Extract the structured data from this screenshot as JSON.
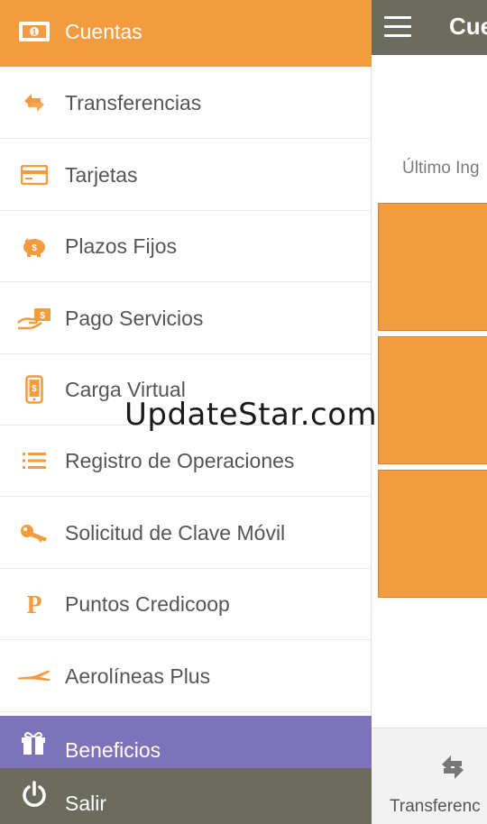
{
  "app": {
    "title": "Cue",
    "last_login": "Último Ing",
    "bottom_nav": {
      "transfer_label": "Transferenc"
    }
  },
  "drawer": {
    "items": [
      {
        "label": "Cuentas",
        "icon": "cash-icon",
        "active": true
      },
      {
        "label": "Transferencias",
        "icon": "transfer-icon"
      },
      {
        "label": "Tarjetas",
        "icon": "credit-card-icon"
      },
      {
        "label": "Plazos Fijos",
        "icon": "piggy-bank-icon"
      },
      {
        "label": "Pago Servicios",
        "icon": "bill-payment-icon"
      },
      {
        "label": "Carga Virtual",
        "icon": "mobile-topup-icon"
      },
      {
        "label": "Registro de Operaciones",
        "icon": "list-icon"
      },
      {
        "label": "Solicitud de Clave Móvil",
        "icon": "key-icon"
      },
      {
        "label": "Puntos Credicoop",
        "icon": "points-p-icon"
      },
      {
        "label": "Aerolíneas Plus",
        "icon": "airline-icon"
      }
    ],
    "beneficios_label": "Beneficios",
    "salir_label": "Salir"
  },
  "watermark": "UpdateStar.com",
  "colors": {
    "accent_orange": "#f29b3f",
    "purple": "#7c73ba",
    "topbar_gray": "#6b6c5e"
  }
}
